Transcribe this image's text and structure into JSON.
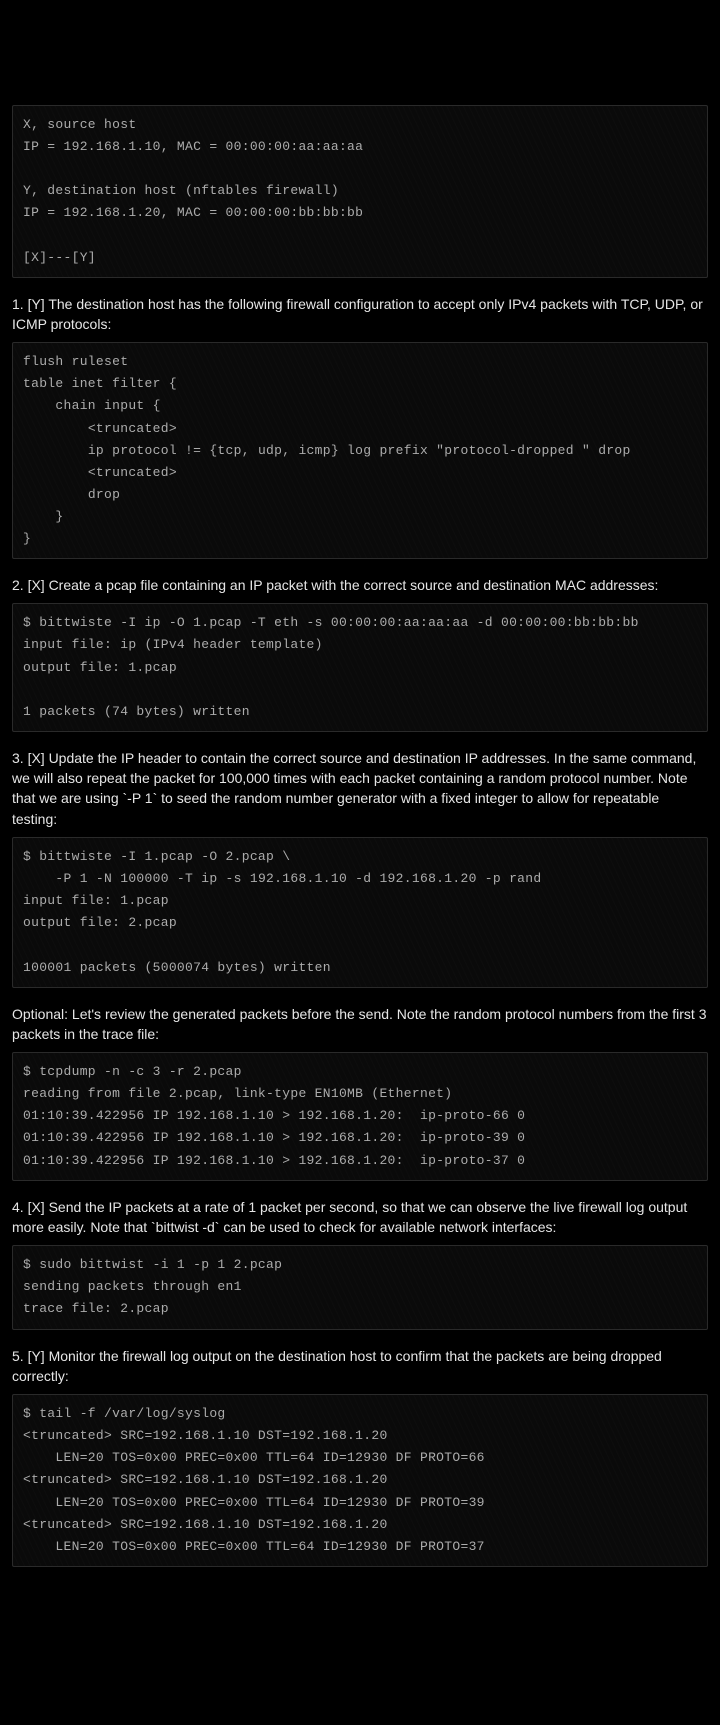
{
  "blocks": {
    "setup": "X, source host\nIP = 192.168.1.10, MAC = 00:00:00:aa:aa:aa\n\nY, destination host (nftables firewall)\nIP = 192.168.1.20, MAC = 00:00:00:bb:bb:bb\n\n[X]---[Y]",
    "step1_text": "1. [Y] The destination host has the following firewall configuration to accept only IPv4 packets with TCP, UDP, or ICMP protocols:",
    "step1_code": "flush ruleset\ntable inet filter {\n    chain input {\n        <truncated>\n        ip protocol != {tcp, udp, icmp} log prefix \"protocol-dropped \" drop\n        <truncated>\n        drop\n    }\n}",
    "step2_text": "2. [X] Create a pcap file containing an IP packet with the correct source and destination MAC addresses:",
    "step2_code": "$ bittwiste -I ip -O 1.pcap -T eth -s 00:00:00:aa:aa:aa -d 00:00:00:bb:bb:bb\ninput file: ip (IPv4 header template)\noutput file: 1.pcap\n\n1 packets (74 bytes) written",
    "step3_text": "3. [X] Update the IP header to contain the correct source and destination IP addresses. In the same command, we will also repeat the packet for 100,000 times with each packet containing a random protocol number. Note that we are using `-P 1` to seed the random number generator with a fixed integer to allow for repeatable testing:",
    "step3_code": "$ bittwiste -I 1.pcap -O 2.pcap \\\n    -P 1 -N 100000 -T ip -s 192.168.1.10 -d 192.168.1.20 -p rand\ninput file: 1.pcap\noutput file: 2.pcap\n\n100001 packets (5000074 bytes) written",
    "optional_text": "Optional: Let's review the generated packets before the send. Note the random protocol numbers from the first 3 packets in the trace file:",
    "optional_code": "$ tcpdump -n -c 3 -r 2.pcap\nreading from file 2.pcap, link-type EN10MB (Ethernet)\n01:10:39.422956 IP 192.168.1.10 > 192.168.1.20:  ip-proto-66 0\n01:10:39.422956 IP 192.168.1.10 > 192.168.1.20:  ip-proto-39 0\n01:10:39.422956 IP 192.168.1.10 > 192.168.1.20:  ip-proto-37 0",
    "step4_text": "4. [X] Send the IP packets at a rate of 1 packet per second, so that we can observe the live firewall log output more easily. Note that `bittwist -d` can be used to check for available network interfaces:",
    "step4_code": "$ sudo bittwist -i 1 -p 1 2.pcap\nsending packets through en1\ntrace file: 2.pcap",
    "step5_text": "5. [Y] Monitor the firewall log output on the destination host to confirm that the packets are being dropped correctly:",
    "step5_code": "$ tail -f /var/log/syslog\n<truncated> SRC=192.168.1.10 DST=192.168.1.20\n    LEN=20 TOS=0x00 PREC=0x00 TTL=64 ID=12930 DF PROTO=66\n<truncated> SRC=192.168.1.10 DST=192.168.1.20\n    LEN=20 TOS=0x00 PREC=0x00 TTL=64 ID=12930 DF PROTO=39\n<truncated> SRC=192.168.1.10 DST=192.168.1.20\n    LEN=20 TOS=0x00 PREC=0x00 TTL=64 ID=12930 DF PROTO=37"
  }
}
